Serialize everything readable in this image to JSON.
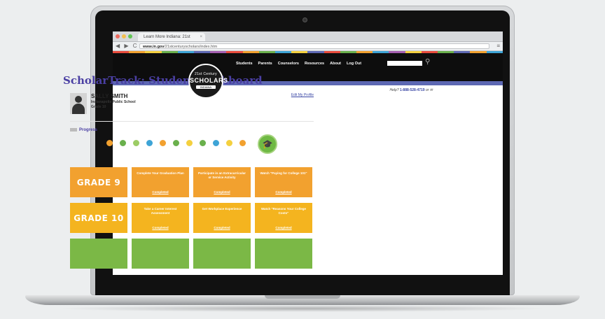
{
  "browser": {
    "tab_title": "Learn More Indiana: 21st",
    "tab_close": "×",
    "nav_buttons": "◀ ▶ C",
    "url_host": "www.in.gov",
    "url_path": "/21stcenturyscholars/index.htm",
    "menu_icon": "≡",
    "traffic_colors": [
      "#ec6a5e",
      "#f4bf4f",
      "#61c554"
    ]
  },
  "color_strip": [
    "#e94c3d",
    "#f2a12f",
    "#f4d03f",
    "#6ab04c",
    "#3ea4d6",
    "#5d68b3",
    "#a55eb0",
    "#e94c3d",
    "#f2a12f",
    "#6ab04c",
    "#3ea4d6",
    "#f4d03f",
    "#5d68b3",
    "#e94c3d",
    "#6ab04c",
    "#f2a12f",
    "#3ea4d6",
    "#a55eb0",
    "#f4d03f",
    "#e94c3d",
    "#6ab04c",
    "#5d68b3",
    "#f2a12f",
    "#3ea4d6"
  ],
  "site": {
    "logo": {
      "line1": "21st Century",
      "line2": "SCHOLARS",
      "line3": "INDIANA"
    },
    "nav": [
      "Students",
      "Parents",
      "Counselors",
      "Resources",
      "About",
      "Log Out"
    ],
    "help_prefix": "Help? ",
    "help_link": "1-888-528-4719",
    "help_suffix": " or ✉"
  },
  "dashboard": {
    "title": "ScholarTrack: Student Dashboard",
    "student_name": "SALLY SMITH",
    "school": "Indianapolis Public School",
    "grade": "Grade 10",
    "edit_link": "Edit My Profile",
    "progress_label": "Progress",
    "progress_dot_colors": [
      "#f2a12f",
      "#6ab04c",
      "#9ccc65",
      "#3ea4d6",
      "#f2a12f",
      "#6ab04c",
      "#f4d03f",
      "#6ab04c",
      "#3ea4d6",
      "#f4d03f",
      "#f2a12f"
    ],
    "completion_icon": "🎓"
  },
  "grades": [
    {
      "label": "GRADE 9",
      "color": "#f2a12f",
      "tasks": [
        {
          "text": "Complete Your Graduation Plan",
          "status": "Completed"
        },
        {
          "text": "Participate in an Extracurricular or Service Activity",
          "status": "Completed"
        },
        {
          "text": "Watch \"Paying for College 101\"",
          "status": "Completed"
        }
      ]
    },
    {
      "label": "GRADE 10",
      "color": "#f4b41f",
      "tasks": [
        {
          "text": "Take a Career Interest Assessment",
          "status": "Completed"
        },
        {
          "text": "Get Workplace Experience",
          "status": "Completed"
        },
        {
          "text": "Watch \"Reasons Your College Costs\"",
          "status": "Completed"
        }
      ]
    },
    {
      "label": "",
      "color": "#7bb846",
      "tasks": [
        {
          "text": "",
          "status": ""
        },
        {
          "text": "",
          "status": ""
        },
        {
          "text": "",
          "status": ""
        }
      ]
    }
  ]
}
